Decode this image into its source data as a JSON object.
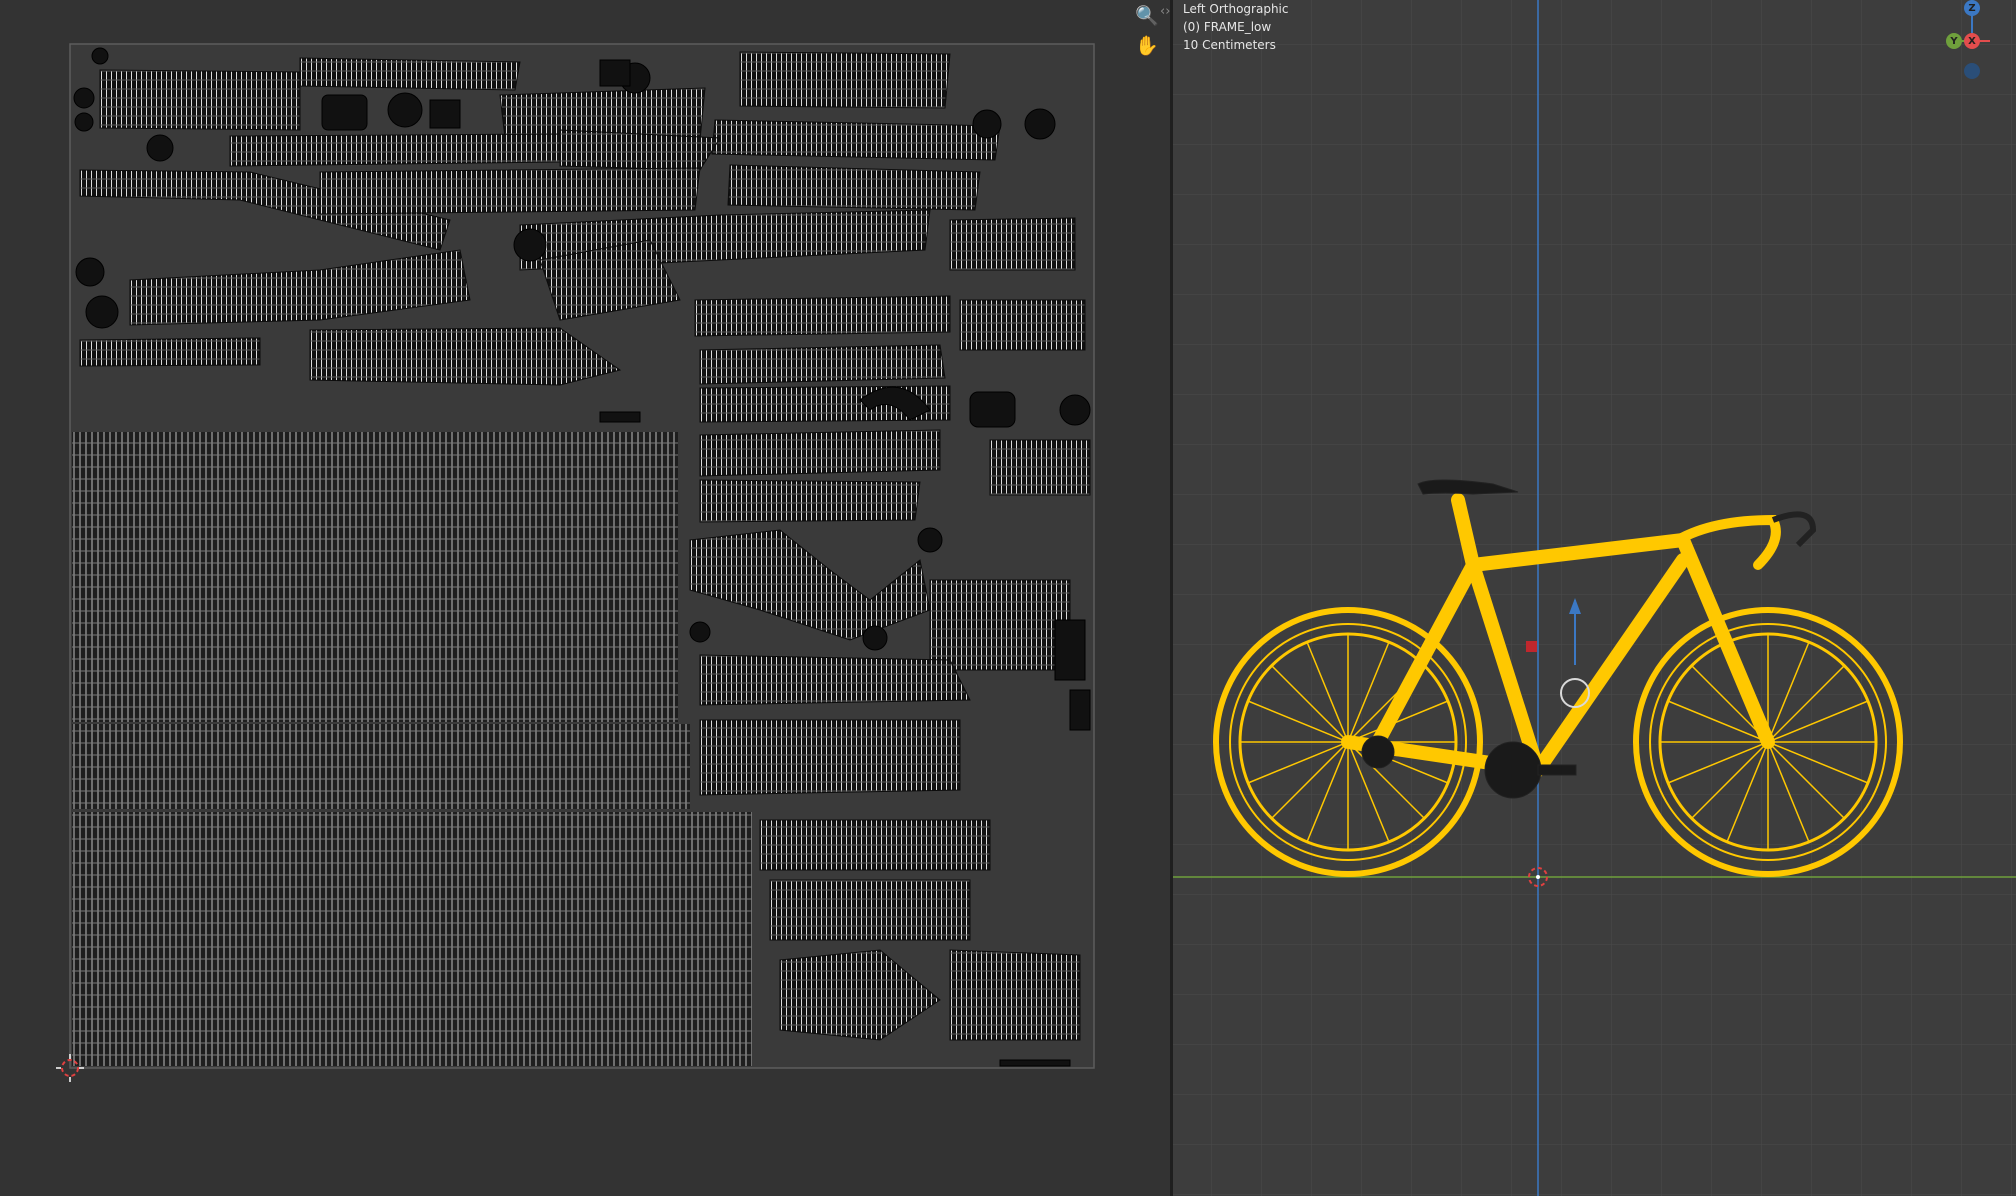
{
  "uv_editor": {
    "tools": [
      {
        "icon": "zoom-icon",
        "glyph": "🔍"
      },
      {
        "icon": "hand-icon",
        "glyph": "✋"
      }
    ],
    "collapse_icon": "chevron-left-icon",
    "colors": {
      "background": "#333333",
      "uv_bounds": "#595959",
      "islands": "#141414",
      "wire": "#d9d9d9"
    }
  },
  "viewport": {
    "view_name": "Left Orthographic",
    "object_name": "(0) FRAME_low",
    "scale": "10 Centimeters",
    "gizmo": {
      "z": "Z",
      "x": "X",
      "y": "Y"
    },
    "colors": {
      "background": "#3d3d3d",
      "grid": "#474747",
      "wire": "#ffc800",
      "z_axis": "#3b78c4",
      "y_axis": "#6fa03c",
      "x_axis": "#e34d4d"
    }
  }
}
